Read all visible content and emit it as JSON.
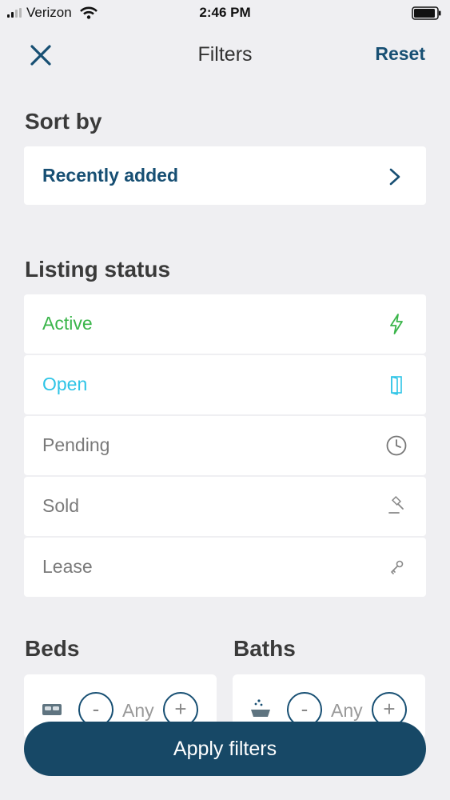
{
  "status_bar": {
    "carrier": "Verizon",
    "time": "2:46 PM"
  },
  "nav": {
    "title": "Filters",
    "reset_label": "Reset"
  },
  "sort": {
    "title": "Sort by",
    "value": "Recently added"
  },
  "listing_status": {
    "title": "Listing status",
    "items": [
      {
        "label": "Active",
        "color": "#3ab54a",
        "icon": "bolt-icon"
      },
      {
        "label": "Open",
        "color": "#2ec4e6",
        "icon": "door-icon"
      },
      {
        "label": "Pending",
        "color": "#7a7a7a",
        "icon": "clock-icon"
      },
      {
        "label": "Sold",
        "color": "#7a7a7a",
        "icon": "gavel-icon"
      },
      {
        "label": "Lease",
        "color": "#7a7a7a",
        "icon": "key-icon"
      }
    ]
  },
  "beds": {
    "title": "Beds",
    "value": "Any",
    "minus": "-",
    "plus": "+"
  },
  "baths": {
    "title": "Baths",
    "value": "Any",
    "minus": "-",
    "plus": "+"
  },
  "apply_label": "Apply filters",
  "colors": {
    "brand": "#174f73",
    "background": "#efeff2"
  }
}
